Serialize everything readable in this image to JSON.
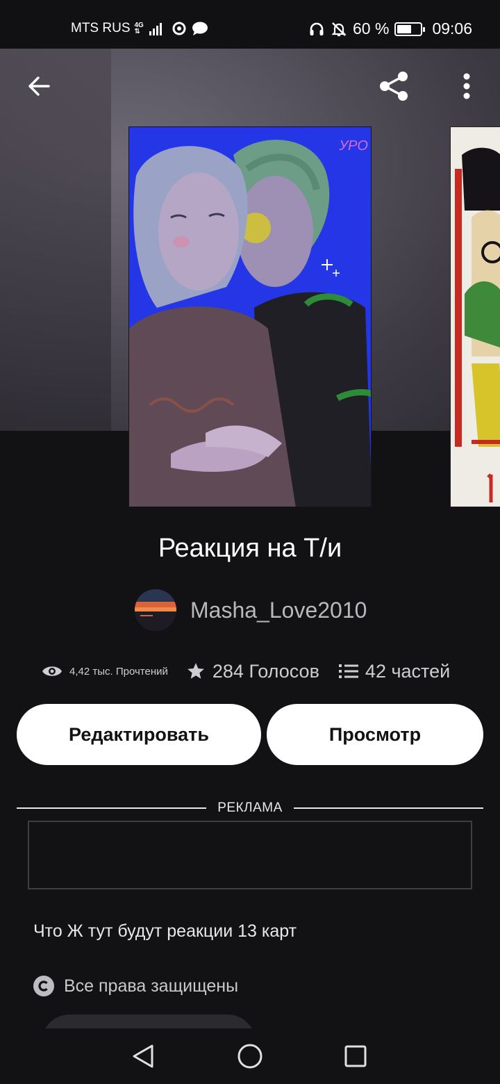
{
  "status_bar": {
    "carrier": "MTS RUS",
    "network": "4G",
    "battery_percent": "60 %",
    "battery_level": 0.6,
    "time": "09:06"
  },
  "header": {
    "back_icon": "arrow-left-icon",
    "share_icon": "share-icon",
    "menu_icon": "more-vertical-icon"
  },
  "story": {
    "cover_signature": "УРО",
    "title": "Реакция на Т/и",
    "author": "Masha_Love2010",
    "stats": {
      "reads": "4,42 тыс. Прочтений",
      "votes": "284 Голосов",
      "parts": "42 частей"
    },
    "description": "Что Ж тут будут реакции 13 карт",
    "copyright": "Все права защищены"
  },
  "actions": {
    "edit_label": "Редактировать",
    "view_label": "Просмотр"
  },
  "ad": {
    "label": "РЕКЛАМА"
  },
  "nav": {
    "back_icon": "triangle-back-icon",
    "home_icon": "circle-home-icon",
    "recents_icon": "square-recents-icon"
  }
}
